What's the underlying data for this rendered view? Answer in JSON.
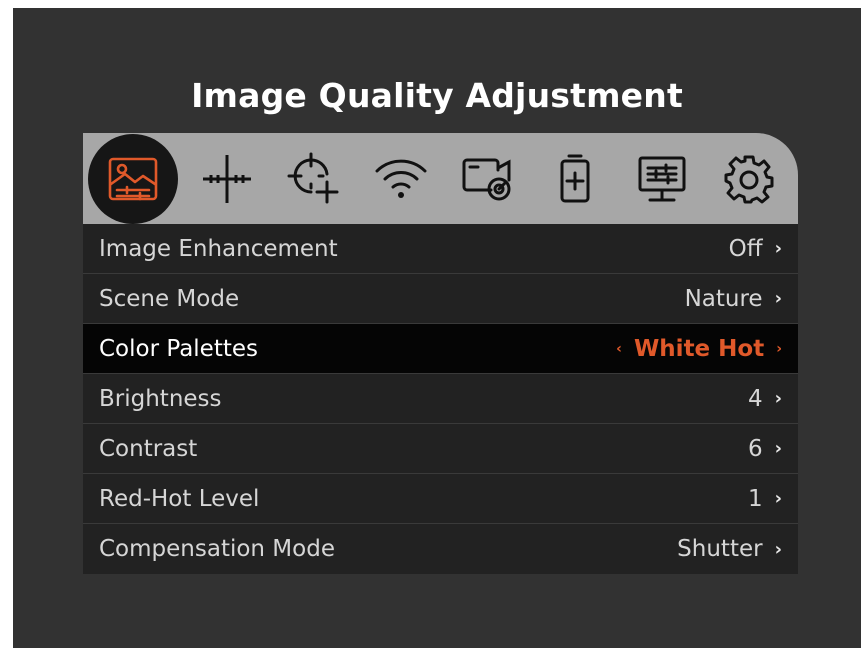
{
  "title": "Image Quality Adjustment",
  "accent_color": "#e0592a",
  "tabs": [
    {
      "icon": "image-quality-icon",
      "active": true
    },
    {
      "icon": "reticle-icon",
      "active": false
    },
    {
      "icon": "zeroing-crosshair-icon",
      "active": false
    },
    {
      "icon": "wifi-icon",
      "active": false
    },
    {
      "icon": "recording-icon",
      "active": false
    },
    {
      "icon": "battery-icon",
      "active": false
    },
    {
      "icon": "display-settings-icon",
      "active": false
    },
    {
      "icon": "gear-icon",
      "active": false
    }
  ],
  "menu": [
    {
      "label": "Image Enhancement",
      "value": "Off",
      "arrow": "›"
    },
    {
      "label": "Scene Mode",
      "value": "Nature",
      "arrow": "›"
    },
    {
      "label": "Color Palettes",
      "value": "White Hot",
      "arrow": "›",
      "left_arrow": "‹",
      "selected": true
    },
    {
      "label": "Brightness",
      "value": "4",
      "arrow": "›"
    },
    {
      "label": "Contrast",
      "value": "6",
      "arrow": "›"
    },
    {
      "label": "Red-Hot Level",
      "value": "1",
      "arrow": "›"
    },
    {
      "label": "Compensation Mode",
      "value": "Shutter",
      "arrow": "›"
    }
  ]
}
